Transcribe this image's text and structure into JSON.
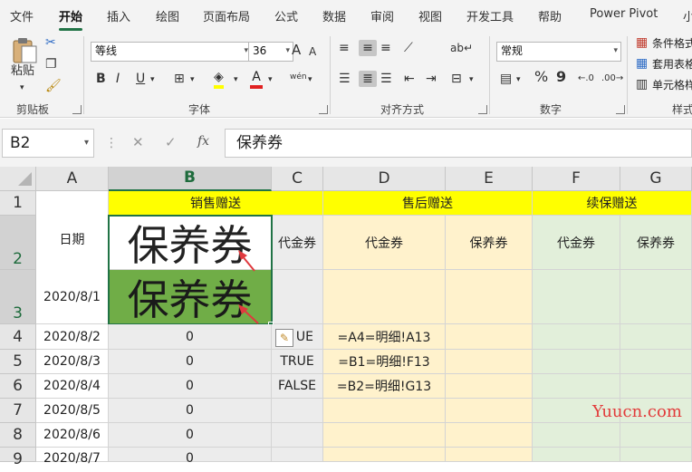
{
  "ribbon": {
    "tabs": [
      "文件",
      "开始",
      "插入",
      "绘图",
      "页面布局",
      "公式",
      "数据",
      "审阅",
      "视图",
      "开发工具",
      "帮助",
      "Power Pivot",
      "小"
    ],
    "active_tab": "开始",
    "clipboard": {
      "paste_label": "粘贴",
      "group_label": "剪贴板"
    },
    "font": {
      "name": "等线",
      "size": "36",
      "group_label": "字体",
      "bold": "B",
      "italic": "I",
      "underline": "U",
      "grow": "A",
      "shrink": "A",
      "phonetic": "wén",
      "font_color_glyph": "A"
    },
    "alignment": {
      "group_label": "对齐方式"
    },
    "number": {
      "format": "常规",
      "group_label": "数字",
      "percent": "%",
      "comma": "9"
    },
    "styles": {
      "conditional": "条件格式",
      "table": "套用表格",
      "cell": "单元格样",
      "group_label": "样式"
    }
  },
  "formula_bar": {
    "name_box": "B2",
    "cancel": "✕",
    "enter": "✓",
    "fx": "fx",
    "content": "保养券"
  },
  "sheet": {
    "columns": [
      "A",
      "B",
      "C",
      "D",
      "E",
      "F",
      "G"
    ],
    "rows": [
      "1",
      "2",
      "3",
      "4",
      "5",
      "6",
      "7",
      "8",
      "9"
    ],
    "header_row1": {
      "sales": "销售赠送",
      "after_sales": "售后赠送",
      "renewal": "续保赠送"
    },
    "date_header": "日期",
    "b2": "保养券",
    "b3": "保养券",
    "c2": "代金券",
    "d2": "代金券",
    "e2": "保养券",
    "f2": "代金券",
    "g2": "保养券",
    "dates": [
      "2020/8/1",
      "2020/8/2",
      "2020/8/3",
      "2020/8/4",
      "2020/8/5",
      "2020/8/6",
      "2020/8/7"
    ],
    "b_values": [
      "0",
      "0",
      "0",
      "0",
      "0",
      "0"
    ],
    "c_values": [
      "UE",
      "TRUE",
      "FALSE"
    ],
    "d_values": [
      "=A4=明细!A13",
      "=B1=明细!F13",
      "=B2=明细!G13"
    ],
    "watermark": "Yuucn.com"
  },
  "colors": {
    "accent": "#217346",
    "yellow": "#ffff00",
    "peach": "#fff2cc",
    "mint": "#e2efda",
    "b3_fill": "#70ad47",
    "arrow": "#e0393e"
  }
}
